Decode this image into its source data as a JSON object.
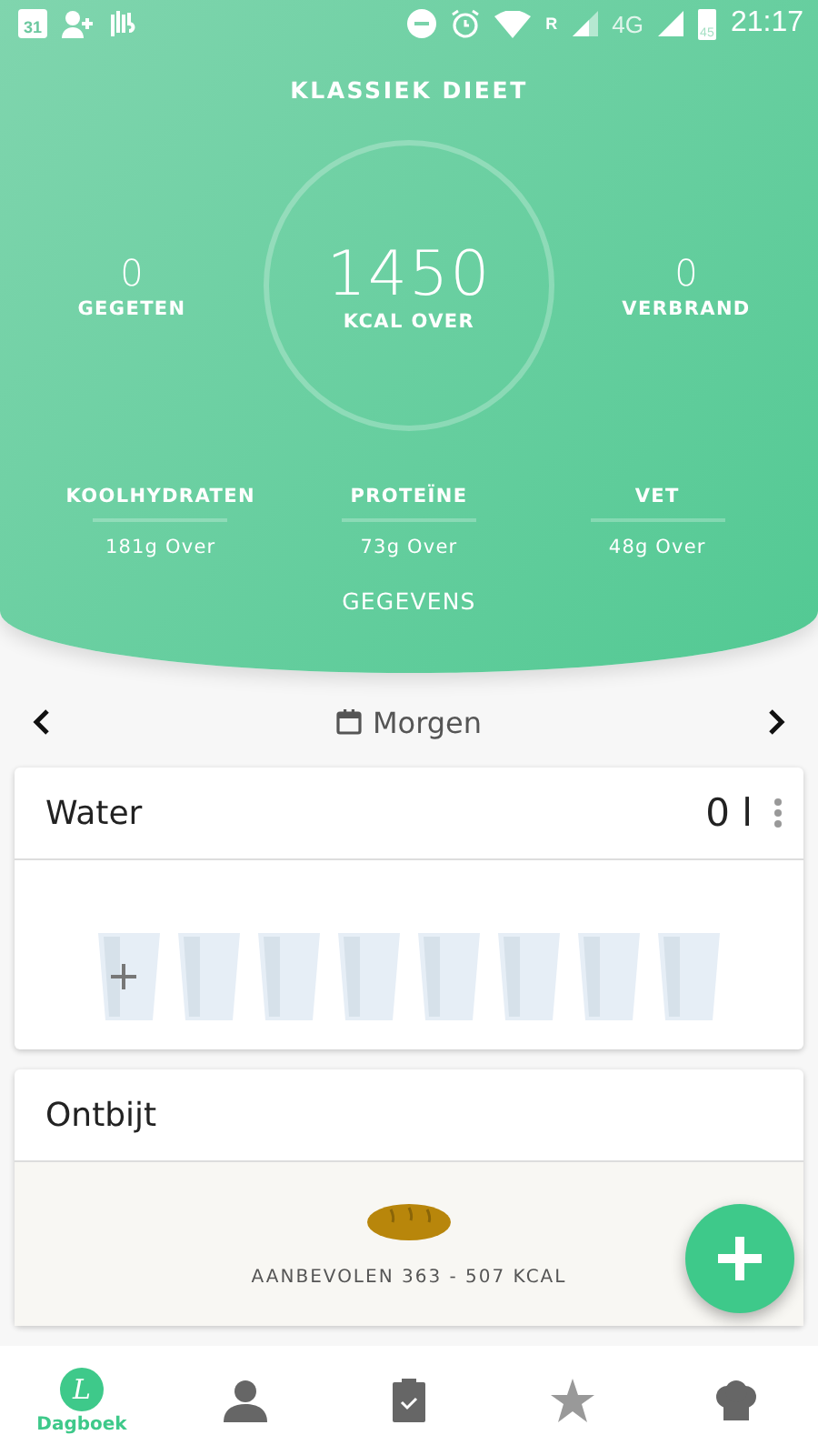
{
  "status_bar": {
    "calendar_day": "31",
    "roaming": "R",
    "network": "4G",
    "battery": "45",
    "time": "21:17"
  },
  "header": {
    "title": "KLASSIEK DIEET",
    "eaten": {
      "value": "0",
      "label": "GEGETEN"
    },
    "remaining": {
      "value": "1450",
      "label": "KCAL OVER"
    },
    "burned": {
      "value": "0",
      "label": "VERBRAND"
    },
    "macros": [
      {
        "name": "KOOLHYDRATEN",
        "value": "181g Over"
      },
      {
        "name": "PROTEÏNE",
        "value": "73g Over"
      },
      {
        "name": "VET",
        "value": "48g Over"
      }
    ],
    "details_link": "GEGEVENS"
  },
  "date_nav": {
    "label": "Morgen"
  },
  "water": {
    "title": "Water",
    "amount": "0 l",
    "glasses": [
      {
        "filled": false
      },
      {
        "filled": false
      },
      {
        "filled": false
      },
      {
        "filled": false
      },
      {
        "filled": false
      },
      {
        "filled": false
      },
      {
        "filled": false
      },
      {
        "filled": false
      }
    ]
  },
  "breakfast": {
    "title": "Ontbijt",
    "recommendation": "AANBEVOLEN 363 - 507 KCAL"
  },
  "bottom_nav": [
    {
      "kind": "diary",
      "logo": "L",
      "label": "Dagboek",
      "selected": true
    },
    {
      "kind": "profile",
      "selected": false
    },
    {
      "kind": "clipboard",
      "selected": false
    },
    {
      "kind": "star",
      "selected": false
    },
    {
      "kind": "chef",
      "selected": false
    }
  ]
}
